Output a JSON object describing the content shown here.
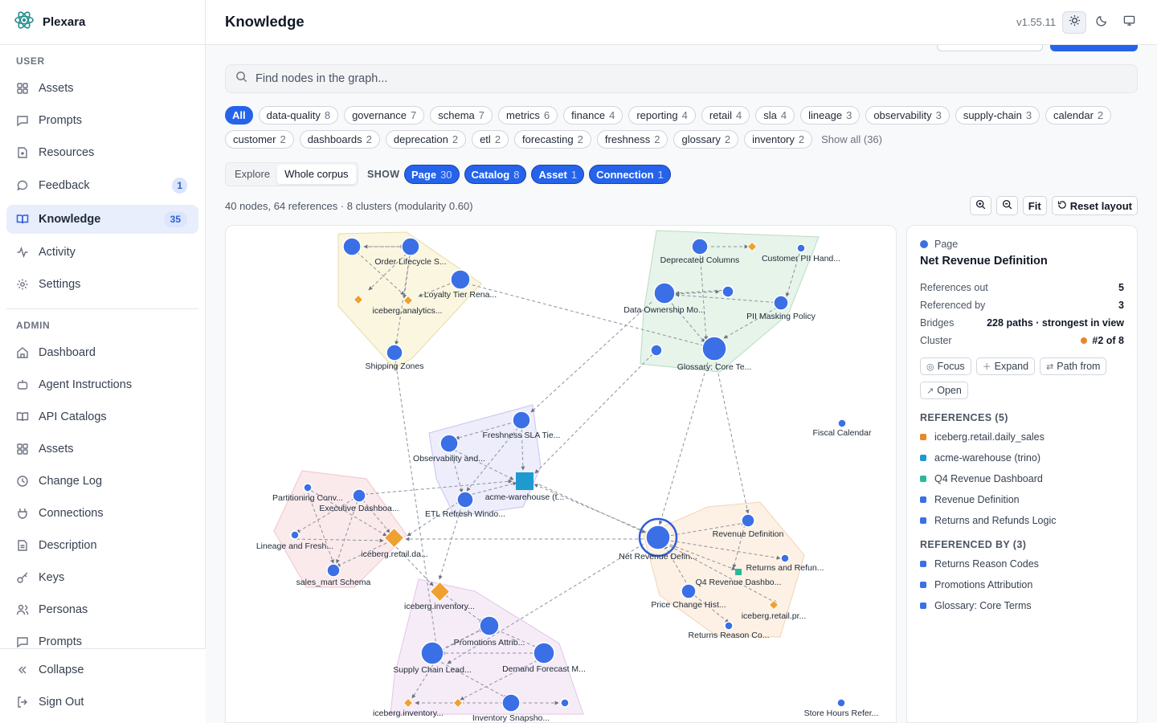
{
  "app": {
    "name": "Plexara",
    "version": "v1.55.11",
    "page_title": "Knowledge"
  },
  "sidebar": {
    "user_section": "USER",
    "user_items": [
      {
        "label": "Assets",
        "icon": "grid-icon"
      },
      {
        "label": "Prompts",
        "icon": "message-square-icon"
      },
      {
        "label": "Resources",
        "icon": "file-icon"
      },
      {
        "label": "Feedback",
        "icon": "message-circle-icon",
        "badge": "1"
      },
      {
        "label": "Knowledge",
        "icon": "book-open-icon",
        "badge": "35",
        "active": true
      },
      {
        "label": "Activity",
        "icon": "activity-icon"
      },
      {
        "label": "Settings",
        "icon": "gear-icon"
      }
    ],
    "admin_section": "ADMIN",
    "admin_items": [
      {
        "label": "Dashboard",
        "icon": "home-icon"
      },
      {
        "label": "Agent Instructions",
        "icon": "bot-icon"
      },
      {
        "label": "API Catalogs",
        "icon": "book-icon"
      },
      {
        "label": "Assets",
        "icon": "grid-icon"
      },
      {
        "label": "Change Log",
        "icon": "clock-icon"
      },
      {
        "label": "Connections",
        "icon": "plug-icon"
      },
      {
        "label": "Description",
        "icon": "document-icon"
      },
      {
        "label": "Keys",
        "icon": "key-icon"
      },
      {
        "label": "Personas",
        "icon": "users-icon"
      },
      {
        "label": "Prompts",
        "icon": "message-square-icon"
      }
    ],
    "footer": {
      "collapse": "Collapse",
      "sign_out": "Sign Out"
    }
  },
  "search": {
    "placeholder": "Find nodes in the graph..."
  },
  "tags": {
    "all_label": "All",
    "row1": [
      {
        "name": "data-quality",
        "count": "8"
      },
      {
        "name": "governance",
        "count": "7"
      },
      {
        "name": "schema",
        "count": "7"
      },
      {
        "name": "metrics",
        "count": "6"
      },
      {
        "name": "finance",
        "count": "4"
      },
      {
        "name": "reporting",
        "count": "4"
      },
      {
        "name": "retail",
        "count": "4"
      },
      {
        "name": "sla",
        "count": "4"
      },
      {
        "name": "lineage",
        "count": "3"
      },
      {
        "name": "observability",
        "count": "3"
      },
      {
        "name": "supply-chain",
        "count": "3"
      },
      {
        "name": "calendar",
        "count": "2"
      }
    ],
    "row2": [
      {
        "name": "customer",
        "count": "2"
      },
      {
        "name": "dashboards",
        "count": "2"
      },
      {
        "name": "deprecation",
        "count": "2"
      },
      {
        "name": "etl",
        "count": "2"
      },
      {
        "name": "forecasting",
        "count": "2"
      },
      {
        "name": "freshness",
        "count": "2"
      },
      {
        "name": "glossary",
        "count": "2"
      },
      {
        "name": "inventory",
        "count": "2"
      }
    ],
    "show_all": "Show all (36)"
  },
  "mode": {
    "explore": "Explore",
    "whole_corpus": "Whole corpus",
    "show_label": "SHOW"
  },
  "show_filters": [
    {
      "name": "Page",
      "count": "30"
    },
    {
      "name": "Catalog",
      "count": "8"
    },
    {
      "name": "Asset",
      "count": "1"
    },
    {
      "name": "Connection",
      "count": "1"
    }
  ],
  "stats": "40 nodes, 64 references · 8 clusters (modularity 0.60)",
  "toolbar": {
    "fit": "Fit",
    "reset": "Reset layout"
  },
  "graph": {
    "labels": [
      "Order Lifecycle S...",
      "Loyalty Tier Rena...",
      "iceberg.analytics...",
      "Shipping Zones",
      "Deprecated Columns",
      "Customer PII Hand...",
      "Data Ownership Mo...",
      "PII Masking Policy",
      "Glossary: Core Te...",
      "Fiscal Calendar",
      "Freshness SLA Tie...",
      "Observability and...",
      "acme-warehouse (t...",
      "ETL Refresh Windo...",
      "Partitioning Conv...",
      "Executive Dashboa...",
      "Lineage and Fresh...",
      "iceberg.retail.da...",
      "sales_mart Schema",
      "Net Revenue Defin...",
      "Revenue Definition",
      "Returns and Refun...",
      "Q4 Revenue Dashbo...",
      "Price Change Hist...",
      "iceberg.retail.pr...",
      "Returns Reason Co...",
      "iceberg.inventory...",
      "Promotions Attrib...",
      "Supply Chain Lead...",
      "Demand Forecast M...",
      "iceberg.inventory...",
      "Inventory Snapsho...",
      "Store Hours Refer..."
    ]
  },
  "detail": {
    "kind": "Page",
    "title": "Net Revenue Definition",
    "metrics": [
      {
        "k": "References out",
        "v": "5"
      },
      {
        "k": "Referenced by",
        "v": "3"
      },
      {
        "k": "Bridges",
        "v": "228 paths · strongest in view"
      },
      {
        "k": "Cluster",
        "v": "#2 of 8"
      }
    ],
    "actions": [
      "Focus",
      "Expand",
      "Path from",
      "Open"
    ],
    "references_title": "REFERENCES (5)",
    "references": [
      {
        "label": "iceberg.retail.daily_sales",
        "color": "#e8872a"
      },
      {
        "label": "acme-warehouse (trino)",
        "color": "#1d9bd1"
      },
      {
        "label": "Q4 Revenue Dashboard",
        "color": "#2bb89a"
      },
      {
        "label": "Revenue Definition",
        "color": "#3b6fe6"
      },
      {
        "label": "Returns and Refunds Logic",
        "color": "#3b6fe6"
      }
    ],
    "referenced_by_title": "REFERENCED BY (3)",
    "referenced_by": [
      {
        "label": "Returns Reason Codes",
        "color": "#3b6fe6"
      },
      {
        "label": "Promotions Attribution",
        "color": "#3b6fe6"
      },
      {
        "label": "Glossary: Core Terms",
        "color": "#3b6fe6"
      }
    ]
  },
  "colors": {
    "accent": "#2563eb",
    "page_node": "#3b6fe6",
    "catalog_node": "#f0a030",
    "asset_node": "#1d9bd1",
    "connection_node": "#2bb89a"
  }
}
